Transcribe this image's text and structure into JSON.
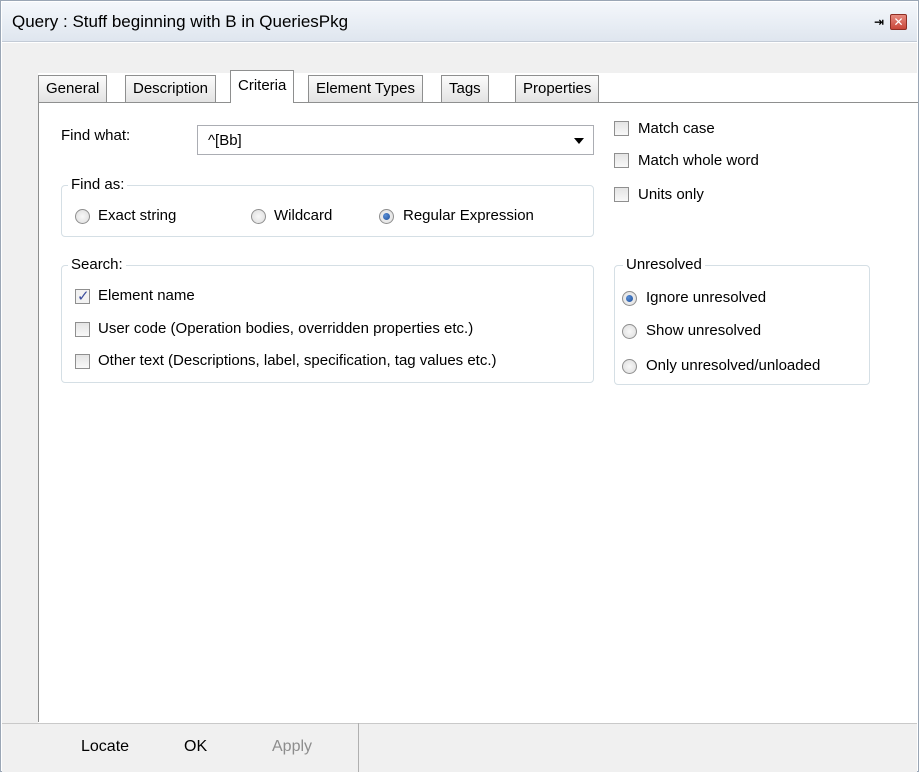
{
  "window": {
    "title": "Query : Stuff beginning with B in QueriesPkg",
    "pin_glyph": "⇥",
    "close_glyph": "✕"
  },
  "tabs": [
    {
      "label": "General",
      "active": false
    },
    {
      "label": "Description",
      "active": false
    },
    {
      "label": "Criteria",
      "active": true
    },
    {
      "label": "Element Types",
      "active": false
    },
    {
      "label": "Tags",
      "active": false
    },
    {
      "label": "Properties",
      "active": false
    }
  ],
  "find": {
    "label": "Find what:",
    "value": "^[Bb]"
  },
  "options": {
    "match_case": {
      "label": "Match case",
      "checked": false
    },
    "match_whole_word": {
      "label": "Match whole word",
      "checked": false
    },
    "units_only": {
      "label": "Units only",
      "checked": false
    }
  },
  "find_as": {
    "legend": "Find as:",
    "options": [
      {
        "label": "Exact string",
        "selected": false
      },
      {
        "label": "Wildcard",
        "selected": false
      },
      {
        "label": "Regular Expression",
        "selected": true
      }
    ]
  },
  "search": {
    "legend": "Search:",
    "options": [
      {
        "label": "Element name",
        "checked": true
      },
      {
        "label": "User code (Operation bodies, overridden properties etc.)",
        "checked": false
      },
      {
        "label": "Other text (Descriptions, label, specification, tag values etc.)",
        "checked": false
      }
    ]
  },
  "unresolved": {
    "legend": "Unresolved",
    "options": [
      {
        "label": "Ignore unresolved",
        "selected": true
      },
      {
        "label": "Show unresolved",
        "selected": false
      },
      {
        "label": "Only unresolved/unloaded",
        "selected": false
      }
    ]
  },
  "buttons": {
    "locate": "Locate",
    "ok": "OK",
    "apply": "Apply"
  },
  "colors": {
    "check_mark": "#3e4f9e",
    "radio_dot": "#1d4d99",
    "disabled_text": "#8d8d8d"
  }
}
